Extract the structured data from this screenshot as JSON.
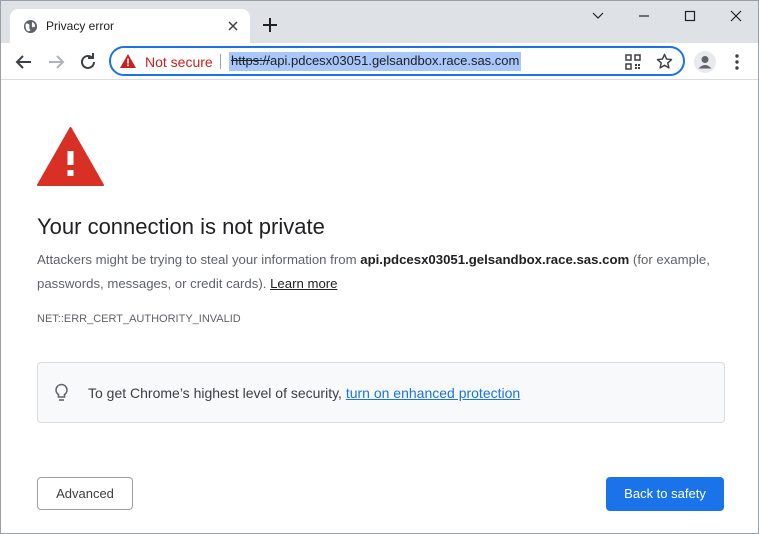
{
  "tab": {
    "title": "Privacy error",
    "favicon": "globe-icon"
  },
  "window_controls": [
    "minimize-icon",
    "maximize-icon",
    "close-icon"
  ],
  "toolbar": {
    "security_label": "Not secure",
    "url_scheme": "https://",
    "url_host": "api.pdcesx03051.gelsandbox.race.sas.com"
  },
  "page": {
    "heading": "Your connection is not private",
    "body_prefix": "Attackers might be trying to steal your information from ",
    "body_host": "api.pdcesx03051.gelsandbox.race.sas.com",
    "body_suffix": " (for example, passwords, messages, or credit cards).",
    "learn_more": "Learn more",
    "error_code": "NET::ERR_CERT_AUTHORITY_INVALID",
    "security_prompt": "To get Chrome’s highest level of security, ",
    "security_link": "turn on enhanced protection",
    "advanced_label": "Advanced",
    "back_label": "Back to safety"
  },
  "colors": {
    "accent": "#1a73e8",
    "warning_red": "#d93025",
    "not_secure_red": "#c5221f",
    "tabstrip": "#dee1e6"
  }
}
